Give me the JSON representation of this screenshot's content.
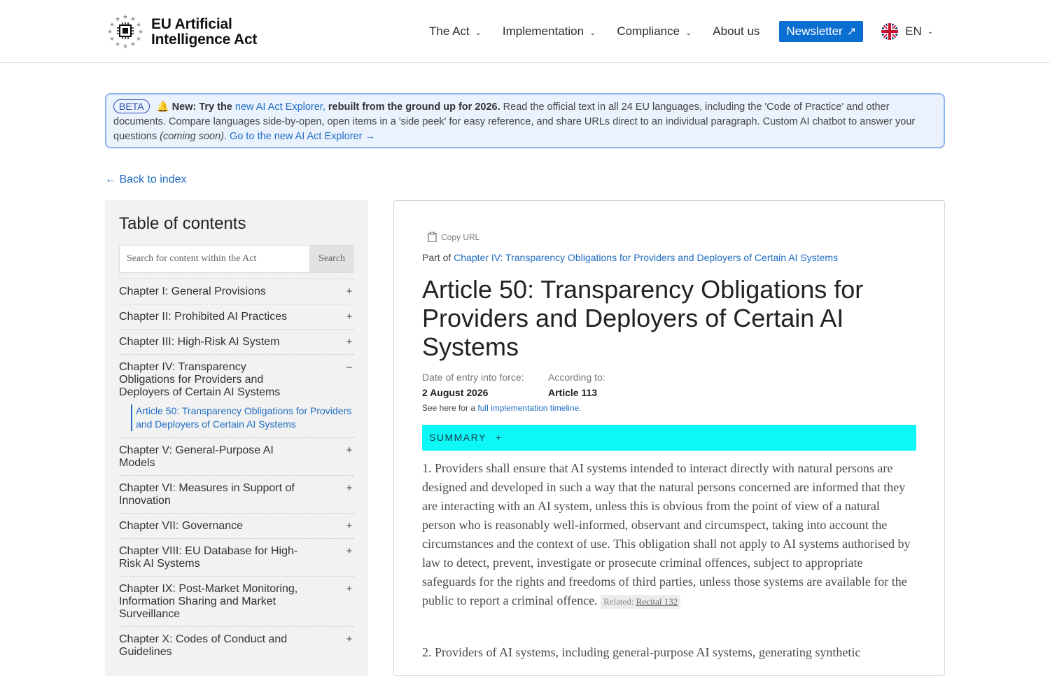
{
  "header": {
    "logo_line1": "EU Artificial",
    "logo_line2": "Intelligence Act",
    "nav": [
      {
        "label": "The Act"
      },
      {
        "label": "Implementation"
      },
      {
        "label": "Compliance"
      },
      {
        "label": "About us"
      }
    ],
    "newsletter_label": "Newsletter",
    "lang_label": "EN"
  },
  "banner": {
    "beta": "BETA",
    "bell": "🔔",
    "new_prefix": "New: Try the",
    "explorer_link": "new AI Act Explorer,",
    "rebuilt": "rebuilt from the ground up for 2026.",
    "body": "Read the official text in all 24 EU languages, including the 'Code of Practice' and other documents. Compare languages side-by-open, open items in a 'side peek' for easy reference, and share URLs direct to an individual paragraph. Custom AI chatbot to answer your questions",
    "coming_soon": "(coming soon)",
    "go_link": "Go to the new AI Act Explorer →"
  },
  "back_link": "← Back to index",
  "toc": {
    "title": "Table of contents",
    "search_placeholder": "Search for content within the Act",
    "search_button": "Search",
    "items": [
      {
        "label": "Chapter I: General Provisions",
        "toggle": "+"
      },
      {
        "label": "Chapter II: Prohibited AI Practices",
        "toggle": "+"
      },
      {
        "label": "Chapter III: High-Risk AI System",
        "toggle": "+"
      },
      {
        "label": "Chapter IV: Transparency Obligations for Providers and Deployers of Certain AI Systems",
        "toggle": "–"
      },
      {
        "label": "Chapter V: General-Purpose AI Models",
        "toggle": "+"
      },
      {
        "label": "Chapter VI: Measures in Support of Innovation",
        "toggle": "+"
      },
      {
        "label": "Chapter VII: Governance",
        "toggle": "+"
      },
      {
        "label": "Chapter VIII: EU Database for High-Risk AI Systems",
        "toggle": "+"
      },
      {
        "label": "Chapter IX: Post-Market Monitoring, Information Sharing and Market Surveillance",
        "toggle": "+"
      },
      {
        "label": "Chapter X: Codes of Conduct and Guidelines",
        "toggle": "+"
      }
    ],
    "sub_item": "Article 50: Transparency Obligations for Providers and Deployers of Certain AI Systems"
  },
  "article": {
    "copy_url": "Copy URL",
    "part_of_prefix": "Part of",
    "part_of_link": "Chapter IV: Transparency Obligations for Providers and Deployers of Certain AI Systems",
    "title": "Article 50: Transparency Obligations for Providers and Deployers of Certain AI Systems",
    "entry_label": "Date of entry into force:",
    "entry_value": "2 August 2026",
    "according_label": "According to:",
    "according_value": "Article 113",
    "timeline_prefix": "See here for a",
    "timeline_link": "full implementation timeline.",
    "summary_label": "SUMMARY",
    "summary_toggle": "+",
    "para1": "1. Providers shall ensure that AI systems intended to interact directly with natural persons are designed and developed in such a way that the natural persons concerned are informed that they are interacting with an AI system, unless this is obvious from the point of view of a natural person who is reasonably well-informed, observant and circumspect, taking into account the circumstances and the context of use. This obligation shall not apply to AI systems authorised by law to detect, prevent, investigate or prosecute criminal offences, subject to appropriate safeguards for the rights and freedoms of third parties, unless those systems are available for the public to report a criminal offence.",
    "related_prefix": "Related:",
    "related_link": "Recital 132",
    "para2": "2. Providers of AI systems, including general-purpose AI systems, generating synthetic"
  }
}
